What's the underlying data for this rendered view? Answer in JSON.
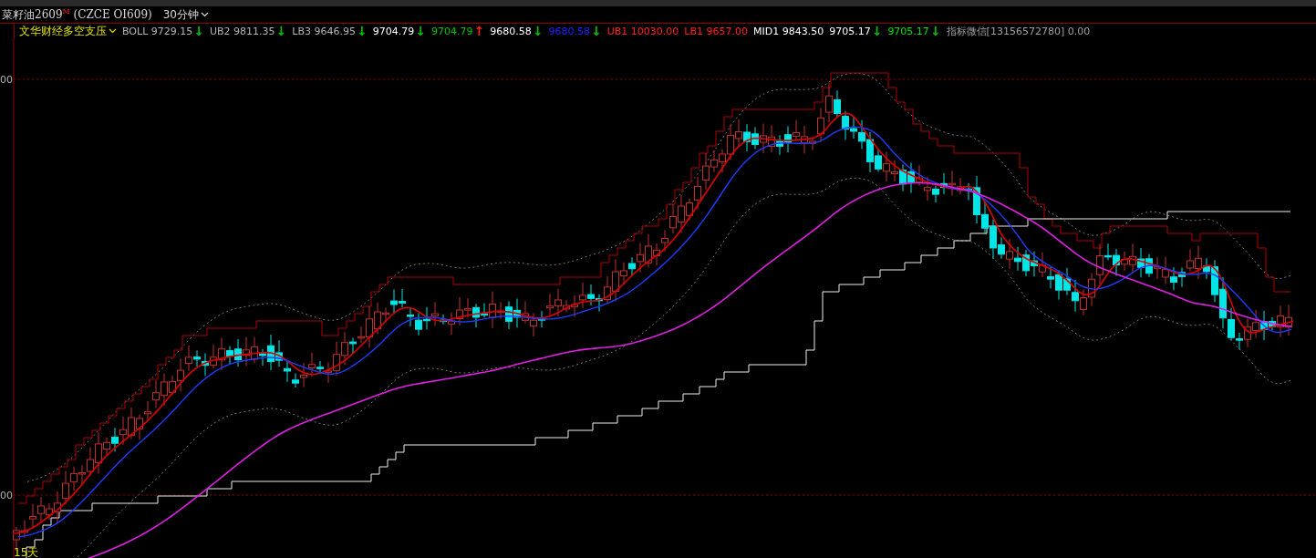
{
  "title_bar": {
    "symbol": "菜籽油2609",
    "marker": "M",
    "code": "(CZCE OI609)",
    "period": "30分钟"
  },
  "indicator_bar": {
    "name": "文华财经多空支压",
    "items": [
      {
        "text": "BOLL 9729.15",
        "color": "#b4b4b4",
        "arrow": {
          "symbol": "↓",
          "color": "#00c000"
        }
      },
      {
        "text": "UB2 9811.35",
        "color": "#b4b4b4",
        "arrow": {
          "symbol": "↓",
          "color": "#00c000"
        }
      },
      {
        "text": "LB3 9646.95",
        "color": "#b4b4b4",
        "arrow": {
          "symbol": "↓",
          "color": "#00c000"
        }
      },
      {
        "text": "9704.79",
        "color": "#ffffff",
        "arrow": {
          "symbol": "↓",
          "color": "#00c000"
        }
      },
      {
        "text": "9704.79",
        "color": "#00c000",
        "arrow": {
          "symbol": "↑",
          "color": "#ff2020"
        }
      },
      {
        "text": "9680.58",
        "color": "#ffffff",
        "arrow": {
          "symbol": "↓",
          "color": "#00c000"
        }
      },
      {
        "text": "9680.58",
        "color": "#2020ff",
        "arrow": {
          "symbol": "↓",
          "color": "#00c000"
        }
      },
      {
        "text": "UB1 10030.00",
        "color": "#ff2020"
      },
      {
        "text": "LB1 9657.00",
        "color": "#ff2020"
      },
      {
        "text": "MID1 9843.50",
        "color": "#ffffff"
      },
      {
        "text": "9705.17",
        "color": "#ffffff",
        "arrow": {
          "symbol": "↓",
          "color": "#00c000"
        }
      },
      {
        "text": "9705.17",
        "color": "#00e000",
        "arrow": {
          "symbol": "↓",
          "color": "#00c000"
        }
      },
      {
        "text": "指标微信[13156572780] 0.00",
        "color": "#a0a0a0"
      }
    ]
  },
  "chart": {
    "axis_labels": [
      "00",
      "00"
    ],
    "span_label": "15天"
  }
}
